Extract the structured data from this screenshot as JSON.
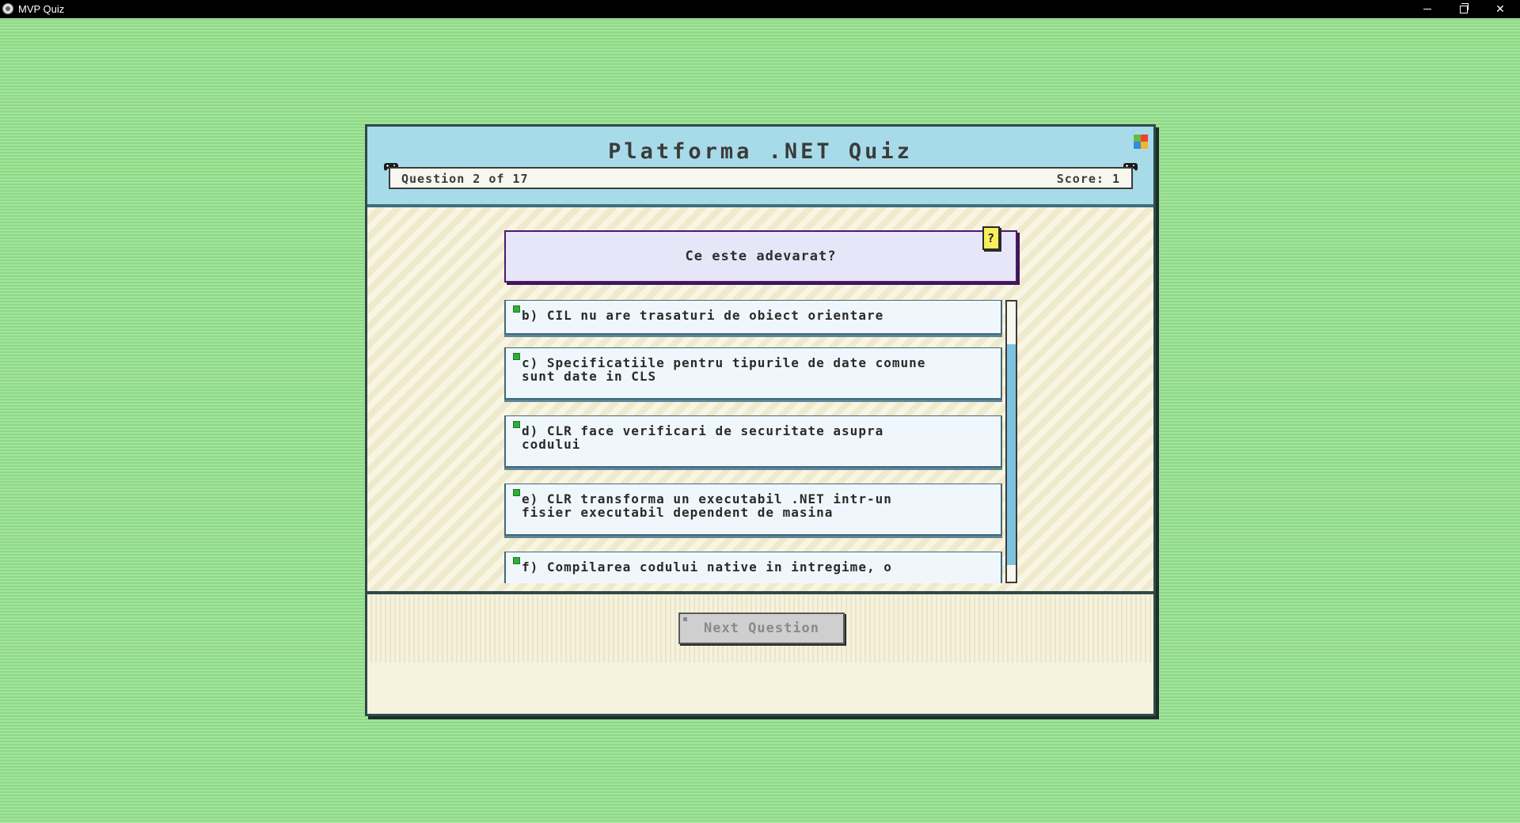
{
  "window": {
    "title": "MVP Quiz",
    "controls": {
      "minimize": "minimize",
      "maximize": "restore",
      "close": "close"
    }
  },
  "quiz": {
    "title": "Platforma .NET Quiz",
    "question_counter": "Question 2 of 17",
    "score": "Score: 1",
    "question": "Ce este adevarat?",
    "help_symbol": "?",
    "answers": [
      {
        "label": "b) CIL nu are trasaturi de obiect orientare"
      },
      {
        "label": "c) Specificatiile pentru tipurile de date comune\nsunt date in CLS"
      },
      {
        "label": "d) CLR face verificari de securitate asupra\ncodului"
      },
      {
        "label": "e) CLR transforma un executabil .NET intr-un\nfisier executabil dependent de masina"
      },
      {
        "label": "f) Compilarea codului native in intregime, o"
      }
    ],
    "next_button": "Next Question",
    "next_button_enabled": false
  },
  "colors": {
    "background": "#a2e49a",
    "header": "#a8dbe9",
    "accent_purple": "#4a1a6b",
    "answer_bullet": "#2fae39",
    "scrollbar_thumb": "#7cc3e0"
  },
  "icons": [
    "app-icon",
    "windows-logo-icon",
    "gamepad-icon",
    "help-icon"
  ]
}
